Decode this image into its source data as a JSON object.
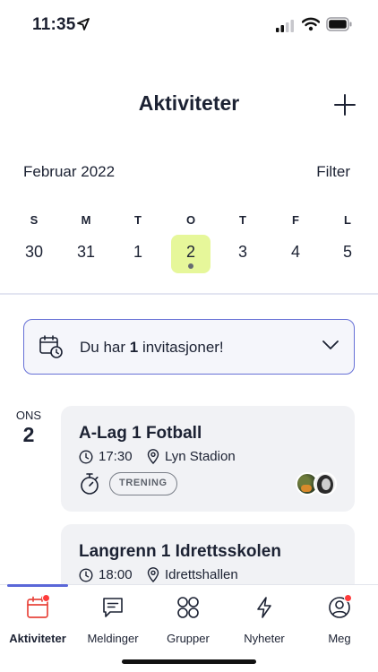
{
  "status_bar": {
    "time": "11:35"
  },
  "header": {
    "title": "Aktiviteter"
  },
  "calendar": {
    "month": "Februar 2022",
    "filter_label": "Filter",
    "days": [
      {
        "letter": "S",
        "num": "30"
      },
      {
        "letter": "M",
        "num": "31"
      },
      {
        "letter": "T",
        "num": "1"
      },
      {
        "letter": "O",
        "num": "2",
        "selected": true
      },
      {
        "letter": "T",
        "num": "3"
      },
      {
        "letter": "F",
        "num": "4"
      },
      {
        "letter": "L",
        "num": "5"
      }
    ],
    "selected_color": "#e6f79a"
  },
  "invitation": {
    "prefix": "Du har ",
    "count": "1",
    "suffix": " invitasjoner!"
  },
  "date_group": {
    "weekday": "ONS",
    "day": "2"
  },
  "activities": [
    {
      "title": "A-Lag 1 Fotball",
      "time": "17:30",
      "location": "Lyn Stadion",
      "tag": "TRENING"
    },
    {
      "title": "Langrenn 1 Idrettsskolen",
      "time": "18:00",
      "location": "Idrettshallen"
    }
  ],
  "tabs": [
    {
      "label": "Aktiviteter",
      "icon": "calendar-icon",
      "active": true,
      "badge": true
    },
    {
      "label": "Meldinger",
      "icon": "chat-icon"
    },
    {
      "label": "Grupper",
      "icon": "groups-icon"
    },
    {
      "label": "Nyheter",
      "icon": "bolt-icon"
    },
    {
      "label": "Meg",
      "icon": "profile-icon",
      "badge": true
    }
  ],
  "colors": {
    "accent": "#5a67d8",
    "badge": "#ff3b3b",
    "card_bg": "#f1f2f5"
  }
}
